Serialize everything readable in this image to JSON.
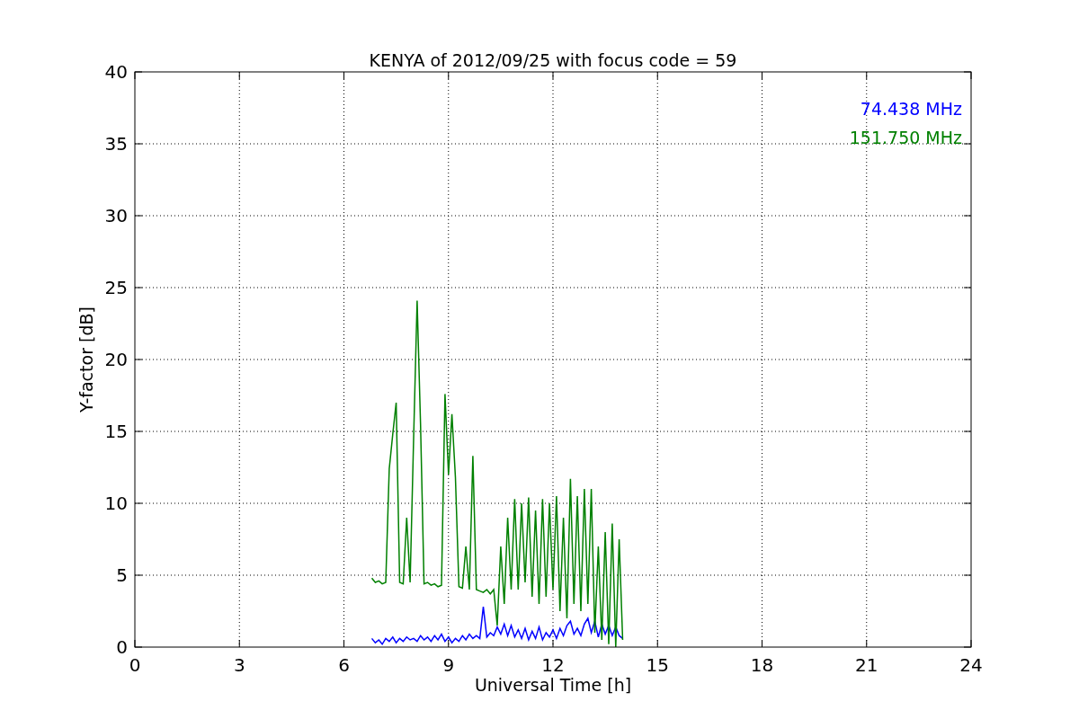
{
  "chart_data": {
    "type": "line",
    "title": "KENYA of 2012/09/25 with focus code = 59",
    "xlabel": "Universal Time [h]",
    "ylabel": "Y-factor [dB]",
    "x": [
      6.8,
      6.9,
      7.0,
      7.1,
      7.2,
      7.3,
      7.4,
      7.5,
      7.6,
      7.7,
      7.8,
      7.9,
      8.0,
      8.1,
      8.2,
      8.3,
      8.4,
      8.5,
      8.6,
      8.7,
      8.8,
      8.9,
      9.0,
      9.1,
      9.2,
      9.3,
      9.4,
      9.5,
      9.6,
      9.7,
      9.8,
      9.9,
      10.0,
      10.1,
      10.2,
      10.3,
      10.4,
      10.5,
      10.6,
      10.7,
      10.8,
      10.9,
      11.0,
      11.1,
      11.2,
      11.3,
      11.4,
      11.5,
      11.6,
      11.7,
      11.8,
      11.9,
      12.0,
      12.1,
      12.2,
      12.3,
      12.4,
      12.5,
      12.6,
      12.7,
      12.8,
      12.9,
      13.0,
      13.1,
      13.2,
      13.3,
      13.4,
      13.5,
      13.6,
      13.7,
      13.8,
      13.9,
      14.0
    ],
    "series": [
      {
        "name": "74.438 MHz",
        "color": "#0000ff",
        "values": [
          0.6,
          0.3,
          0.5,
          0.2,
          0.6,
          0.4,
          0.7,
          0.3,
          0.6,
          0.4,
          0.7,
          0.5,
          0.6,
          0.4,
          0.8,
          0.5,
          0.7,
          0.4,
          0.8,
          0.5,
          0.9,
          0.4,
          0.7,
          0.3,
          0.6,
          0.4,
          0.8,
          0.5,
          0.9,
          0.6,
          0.8,
          0.6,
          2.8,
          0.7,
          1.0,
          0.8,
          1.4,
          0.9,
          1.6,
          0.8,
          1.5,
          0.7,
          1.2,
          0.6,
          1.3,
          0.5,
          1.1,
          0.6,
          1.4,
          0.5,
          1.0,
          0.7,
          1.2,
          0.6,
          1.3,
          0.8,
          1.5,
          1.8,
          0.9,
          1.3,
          0.8,
          1.6,
          2.0,
          1.0,
          1.8,
          0.7,
          1.6,
          0.9,
          1.5,
          0.8,
          1.4,
          0.8,
          0.6
        ]
      },
      {
        "name": "151.750 MHz",
        "color": "#008000",
        "values": [
          4.8,
          4.5,
          4.6,
          4.4,
          4.5,
          12.4,
          14.8,
          17.0,
          4.5,
          4.4,
          9.0,
          4.5,
          14.5,
          24.1,
          15.5,
          4.4,
          4.5,
          4.3,
          4.4,
          4.2,
          4.3,
          17.6,
          12.0,
          16.2,
          11.8,
          4.2,
          4.1,
          7.0,
          4.0,
          13.3,
          4.0,
          3.9,
          3.8,
          4.0,
          3.7,
          4.0,
          1.5,
          7.0,
          3.0,
          9.0,
          4.0,
          10.3,
          4.0,
          10.0,
          4.5,
          10.4,
          3.5,
          9.5,
          3.0,
          10.3,
          3.5,
          10.0,
          4.0,
          10.5,
          2.5,
          9.0,
          2.0,
          11.7,
          3.0,
          10.5,
          2.5,
          11.0,
          3.0,
          11.0,
          1.0,
          7.0,
          0.5,
          8.0,
          0.2,
          8.6,
          0.0,
          7.5,
          0.5
        ]
      }
    ],
    "xlim": [
      0,
      24
    ],
    "ylim": [
      0,
      40
    ],
    "xticks": [
      0,
      3,
      6,
      9,
      12,
      15,
      18,
      21,
      24
    ],
    "yticks": [
      0,
      5,
      10,
      15,
      20,
      25,
      30,
      35,
      40
    ],
    "grid": true
  }
}
